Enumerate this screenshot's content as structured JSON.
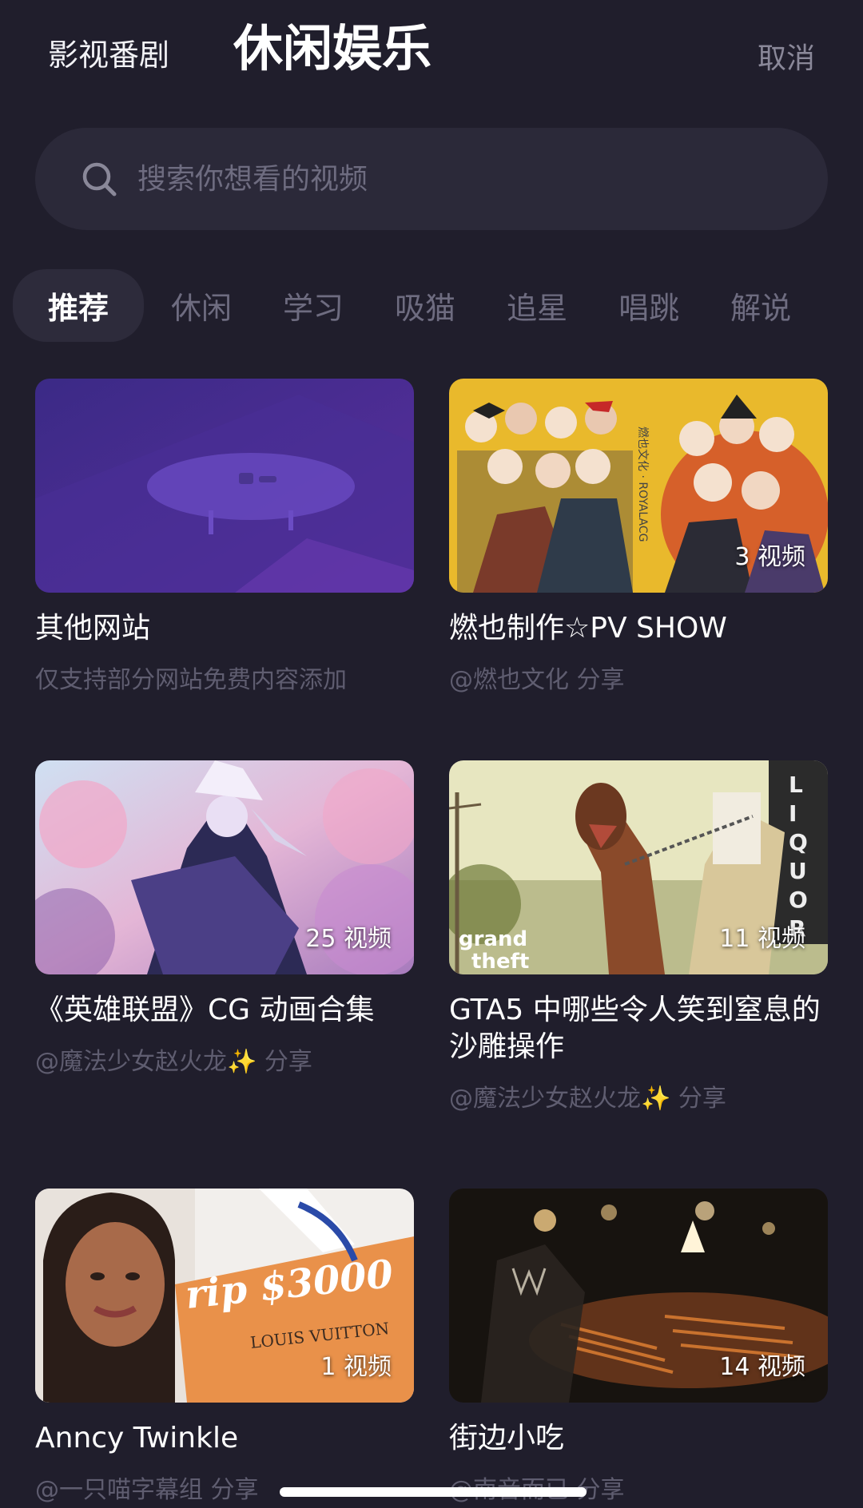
{
  "header": {
    "tab_left": "影视番剧",
    "tab_active": "休闲娱乐",
    "cancel_label": "取消"
  },
  "search": {
    "placeholder": "搜索你想看的视频"
  },
  "categories": [
    "推荐",
    "休闲",
    "学习",
    "吸猫",
    "追星",
    "唱跳",
    "解说"
  ],
  "cards": [
    {
      "title": "其他网站",
      "subtitle": "仅支持部分网站免费内容添加",
      "count": ""
    },
    {
      "title": "燃也制作☆PV SHOW",
      "subtitle": "@燃也文化 分享",
      "count": "3 视频"
    },
    {
      "title": "《英雄联盟》CG 动画合集",
      "subtitle": "@魔法少女赵火龙✨ 分享",
      "count": "25 视频"
    },
    {
      "title": "GTA5 中哪些令人笑到窒息的沙雕操作",
      "subtitle": "@魔法少女赵火龙✨ 分享",
      "count": "11 视频"
    },
    {
      "title": "Anncy Twinkle",
      "subtitle": "@一只喵字幕组 分享",
      "count": "1 视频"
    },
    {
      "title": "街边小吃",
      "subtitle": "@南音而已 分享",
      "count": "14 视频"
    }
  ],
  "thumb_text": {
    "poster_label": "燃也文化 · ROYALACG",
    "bag_text": "rip $3000",
    "bag_brand": "LOUIS VUITTON",
    "gta_logo_line1": "grand",
    "gta_logo_line2": "theft",
    "liquor_sign": "LIQUOR"
  },
  "colors": {
    "background": "#201e2c",
    "search_bg": "#2b2939",
    "muted_text": "#6e6c80",
    "subtitle_text": "#5f5d70"
  }
}
